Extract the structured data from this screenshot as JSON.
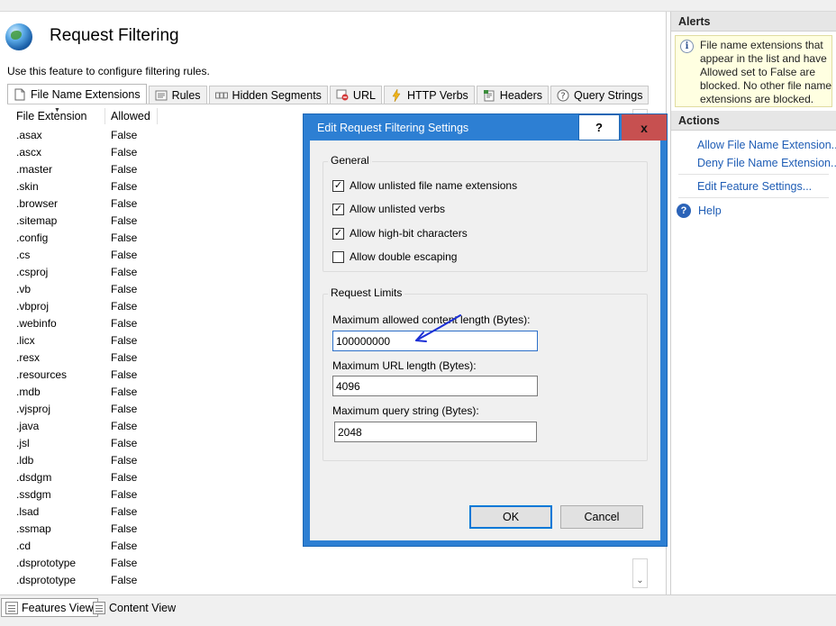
{
  "page": {
    "title": "Request Filtering",
    "description": "Use this feature to configure filtering rules."
  },
  "tabs": [
    {
      "label": "File Name Extensions",
      "icon": "document-icon",
      "active": true
    },
    {
      "label": "Rules",
      "icon": "rules-icon"
    },
    {
      "label": "Hidden Segments",
      "icon": "hidden-segments-icon"
    },
    {
      "label": "URL",
      "icon": "blocked-url-icon"
    },
    {
      "label": "HTTP Verbs",
      "icon": "lightning-icon"
    },
    {
      "label": "Headers",
      "icon": "headers-icon"
    },
    {
      "label": "Query Strings",
      "icon": "question-icon"
    }
  ],
  "list": {
    "columns": [
      "File Extension",
      "Allowed"
    ],
    "rows": [
      [
        ".asax",
        "False"
      ],
      [
        ".ascx",
        "False"
      ],
      [
        ".master",
        "False"
      ],
      [
        ".skin",
        "False"
      ],
      [
        ".browser",
        "False"
      ],
      [
        ".sitemap",
        "False"
      ],
      [
        ".config",
        "False"
      ],
      [
        ".cs",
        "False"
      ],
      [
        ".csproj",
        "False"
      ],
      [
        ".vb",
        "False"
      ],
      [
        ".vbproj",
        "False"
      ],
      [
        ".webinfo",
        "False"
      ],
      [
        ".licx",
        "False"
      ],
      [
        ".resx",
        "False"
      ],
      [
        ".resources",
        "False"
      ],
      [
        ".mdb",
        "False"
      ],
      [
        ".vjsproj",
        "False"
      ],
      [
        ".java",
        "False"
      ],
      [
        ".jsl",
        "False"
      ],
      [
        ".ldb",
        "False"
      ],
      [
        ".dsdgm",
        "False"
      ],
      [
        ".ssdgm",
        "False"
      ],
      [
        ".lsad",
        "False"
      ],
      [
        ".ssmap",
        "False"
      ],
      [
        ".cd",
        "False"
      ],
      [
        ".dsprototype",
        "False"
      ],
      [
        ".dsprototype",
        "False"
      ]
    ]
  },
  "views": {
    "features": "Features View",
    "content": "Content View"
  },
  "alerts": {
    "header": "Alerts",
    "text": "File name extensions that appear in the list and have Allowed set to False are blocked. No other file name extensions are blocked."
  },
  "actions": {
    "header": "Actions",
    "allow_ext": "Allow File Name Extension...",
    "deny_ext": "Deny File Name Extension...",
    "edit_settings": "Edit Feature Settings...",
    "help": "Help"
  },
  "dialog": {
    "title": "Edit Request Filtering Settings",
    "help_btn": "?",
    "close_btn": "x",
    "general_label": "General",
    "checkboxes": [
      {
        "label": "Allow unlisted file name extensions",
        "checked": true
      },
      {
        "label": "Allow unlisted verbs",
        "checked": true
      },
      {
        "label": "Allow high-bit characters",
        "checked": true
      },
      {
        "label": "Allow double escaping",
        "checked": false
      }
    ],
    "limits_label": "Request Limits",
    "max_content_label": "Maximum allowed content length (Bytes):",
    "max_content_value": "100000000",
    "max_url_label": "Maximum URL length (Bytes):",
    "max_url_value": "4096",
    "max_query_label": "Maximum query string (Bytes):",
    "max_query_value": "2048",
    "ok": "OK",
    "cancel": "Cancel"
  },
  "colors": {
    "dialog_frame": "#2d7fd3",
    "close_button": "#c75050",
    "link": "#1f5db5",
    "alert_bg": "#ffffe1",
    "annotation_ink": "#1a2fd6"
  }
}
